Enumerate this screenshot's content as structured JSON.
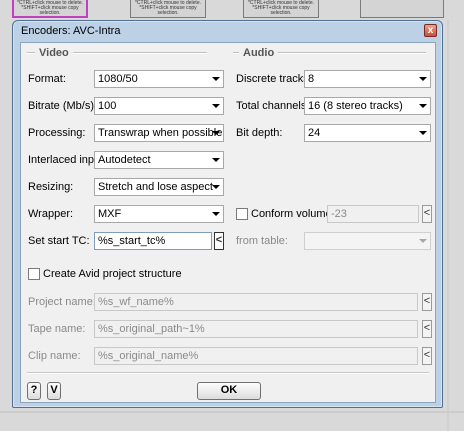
{
  "background": {
    "node_text": "*CTRL+click mouse to delete. *SHIFT+click mouse copy selection."
  },
  "dialog": {
    "title": "Encoders: AVC-Intra",
    "close_label": "x",
    "video_section": "Video",
    "audio_section": "Audio",
    "video": {
      "format_label": "Format:",
      "format_value": "1080/50",
      "bitrate_label": "Bitrate (Mb/s):",
      "bitrate_value": "100",
      "processing_label": "Processing:",
      "processing_value": "Transwrap when possible",
      "interlaced_label": "Interlaced input:",
      "interlaced_value": "Autodetect",
      "resizing_label": "Resizing:",
      "resizing_value": "Stretch and lose aspect",
      "wrapper_label": "Wrapper:",
      "wrapper_value": "MXF",
      "start_tc_label": "Set start TC:",
      "start_tc_value": "%s_start_tc%",
      "start_tc_button": "<"
    },
    "audio": {
      "discrete_label": "Discrete tracks:",
      "discrete_value": "8",
      "channels_label": "Total channels:",
      "channels_value": "16 (8 stereo tracks)",
      "bitdepth_label": "Bit depth:",
      "bitdepth_value": "24",
      "conform_label": "Conform volume to",
      "conform_value": "-23",
      "conform_button": "<",
      "from_table_label": "from table:",
      "from_table_value": ""
    },
    "avid": {
      "checkbox_label": "Create Avid project structure",
      "project_label": "Project name:",
      "project_value": "%s_wf_name%",
      "project_button": "<",
      "tape_label": "Tape name:",
      "tape_value": "%s_original_path~1%",
      "tape_button": "<",
      "clip_label": "Clip name:",
      "clip_value": "%s_original_name%",
      "clip_button": "<"
    },
    "footer": {
      "help_label": "?",
      "v_label": "V",
      "ok_label": "OK"
    }
  },
  "colors": {
    "window_frame": "#bcd0e6",
    "client": "#f0f0f0",
    "selected_node_border": "#c040c0"
  }
}
